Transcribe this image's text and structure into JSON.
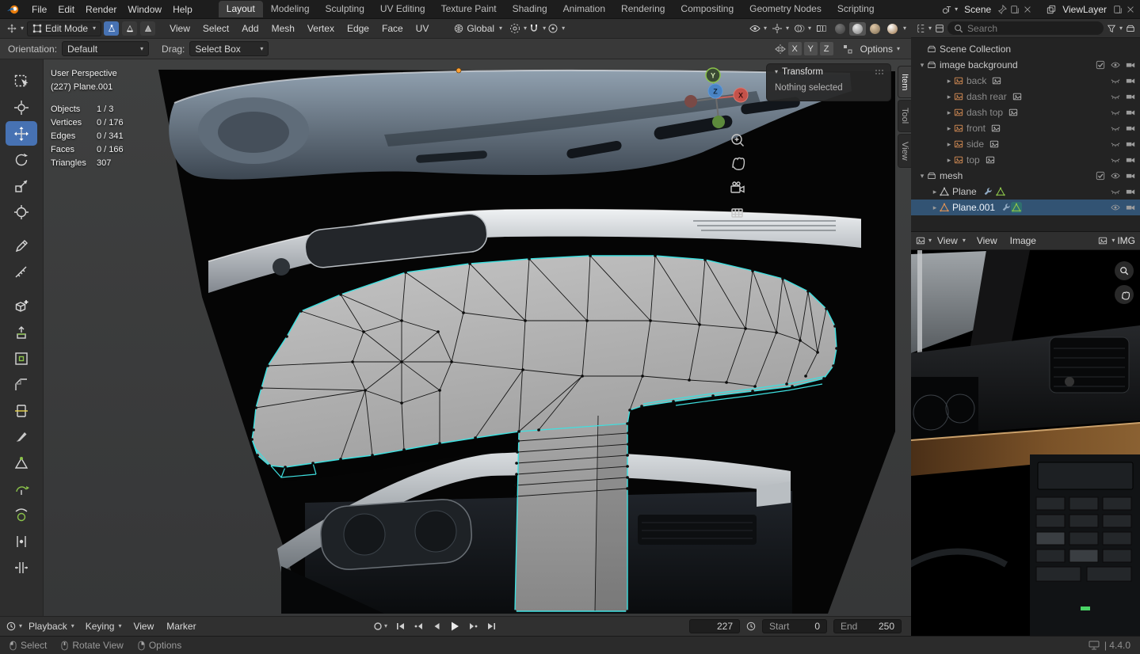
{
  "icons": {
    "chevron_down": "▾",
    "chevron_right": "▸"
  },
  "topbar": {
    "app_menus": [
      "File",
      "Edit",
      "Render",
      "Window",
      "Help"
    ],
    "workspaces": [
      "Layout",
      "Modeling",
      "Sculpting",
      "UV Editing",
      "Texture Paint",
      "Shading",
      "Animation",
      "Rendering",
      "Compositing",
      "Geometry Nodes",
      "Scripting"
    ],
    "scene_name": "Scene",
    "viewlayer_name": "ViewLayer"
  },
  "vp_header": {
    "mode": "Edit Mode",
    "menus": [
      "View",
      "Select",
      "Add",
      "Mesh",
      "Vertex",
      "Edge",
      "Face",
      "UV"
    ],
    "orientation": "Global"
  },
  "tool_settings": {
    "orientation_label": "Orientation:",
    "orientation_value": "Default",
    "drag_label": "Drag:",
    "drag_value": "Select Box",
    "axes": [
      "X",
      "Y",
      "Z"
    ],
    "options_label": "Options"
  },
  "viewport": {
    "view_label": "User Perspective",
    "object_label": "(227) Plane.001",
    "stats": [
      {
        "label": "Objects",
        "value": "1 / 3"
      },
      {
        "label": "Vertices",
        "value": "0 / 176"
      },
      {
        "label": "Edges",
        "value": "0 / 341"
      },
      {
        "label": "Faces",
        "value": "0 / 166"
      },
      {
        "label": "Triangles",
        "value": "307"
      }
    ],
    "gizmo": {
      "x": "X",
      "y": "Y",
      "z": "Z"
    },
    "sidebar_tabs": [
      "Item",
      "Tool",
      "View"
    ],
    "transform_panel": {
      "title": "Transform",
      "message": "Nothing selected"
    }
  },
  "outliner": {
    "search_placeholder": "Search",
    "scene_collection": "Scene Collection",
    "collections": [
      {
        "name": "image background",
        "items": [
          "back",
          "dash rear",
          "dash top",
          "front",
          "side",
          "top"
        ]
      },
      {
        "name": "mesh",
        "items": [
          "Plane",
          "Plane.001"
        ]
      }
    ]
  },
  "image_editor": {
    "mode": "View",
    "menus": [
      "View",
      "Image"
    ],
    "image_name": "IMG"
  },
  "timeline": {
    "playback_label": "Playback",
    "keying_label": "Keying",
    "menus": [
      "View",
      "Marker"
    ],
    "current_frame": "227",
    "start_label": "Start",
    "start_value": "0",
    "end_label": "End",
    "end_value": "250"
  },
  "statusbar": {
    "hints": [
      "Select",
      "Rotate View",
      "Options"
    ],
    "version": "| 4.4.0"
  },
  "colors": {
    "accent_blue": "#4772b3",
    "selection_cyan": "#3ee0e0",
    "selected_row": "#325373"
  }
}
